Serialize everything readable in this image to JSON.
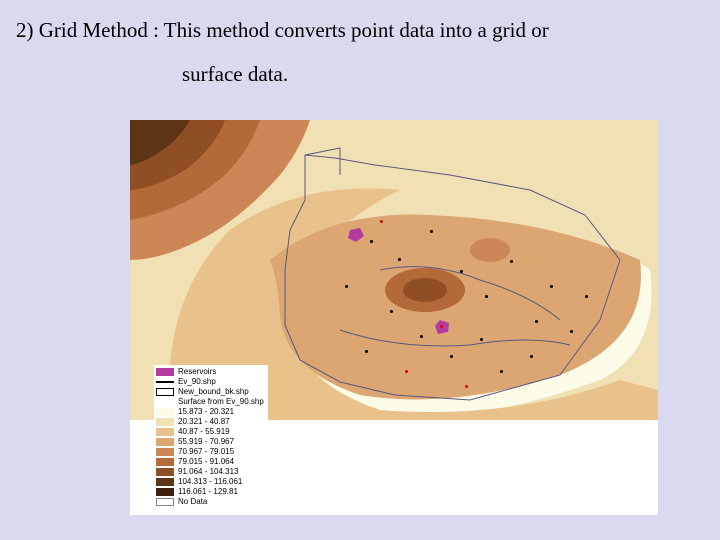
{
  "heading": {
    "line1": "2) Grid Method : This method converts point data into a grid or",
    "line2": "surface data."
  },
  "legend": {
    "reservoirs_label": "Reservoirs",
    "elev_shp_label": "Ev_90.shp",
    "new_bound_label": "New_bound_bk.shp",
    "surface_header": "Surface from Ev_90.shp",
    "classes": [
      {
        "label": "15.873 - 20.321",
        "color": "#fcfbe8"
      },
      {
        "label": "20.321 - 40.87",
        "color": "#f2e0b5"
      },
      {
        "label": "40.87 - 55.919",
        "color": "#e9c28b"
      },
      {
        "label": "55.919 - 70.967",
        "color": "#dca673"
      },
      {
        "label": "70.967 - 79.015",
        "color": "#cd8756"
      },
      {
        "label": "79.015 - 91.064",
        "color": "#b46a38"
      },
      {
        "label": "91.064 - 104.313",
        "color": "#8f4e24"
      },
      {
        "label": "104.313 - 116.061",
        "color": "#5e3416"
      },
      {
        "label": "116.061 - 129.81",
        "color": "#3c200d"
      },
      {
        "label": "No Data",
        "color": "#ffffff"
      }
    ],
    "reservoir_swatch": "#b43aa0"
  }
}
